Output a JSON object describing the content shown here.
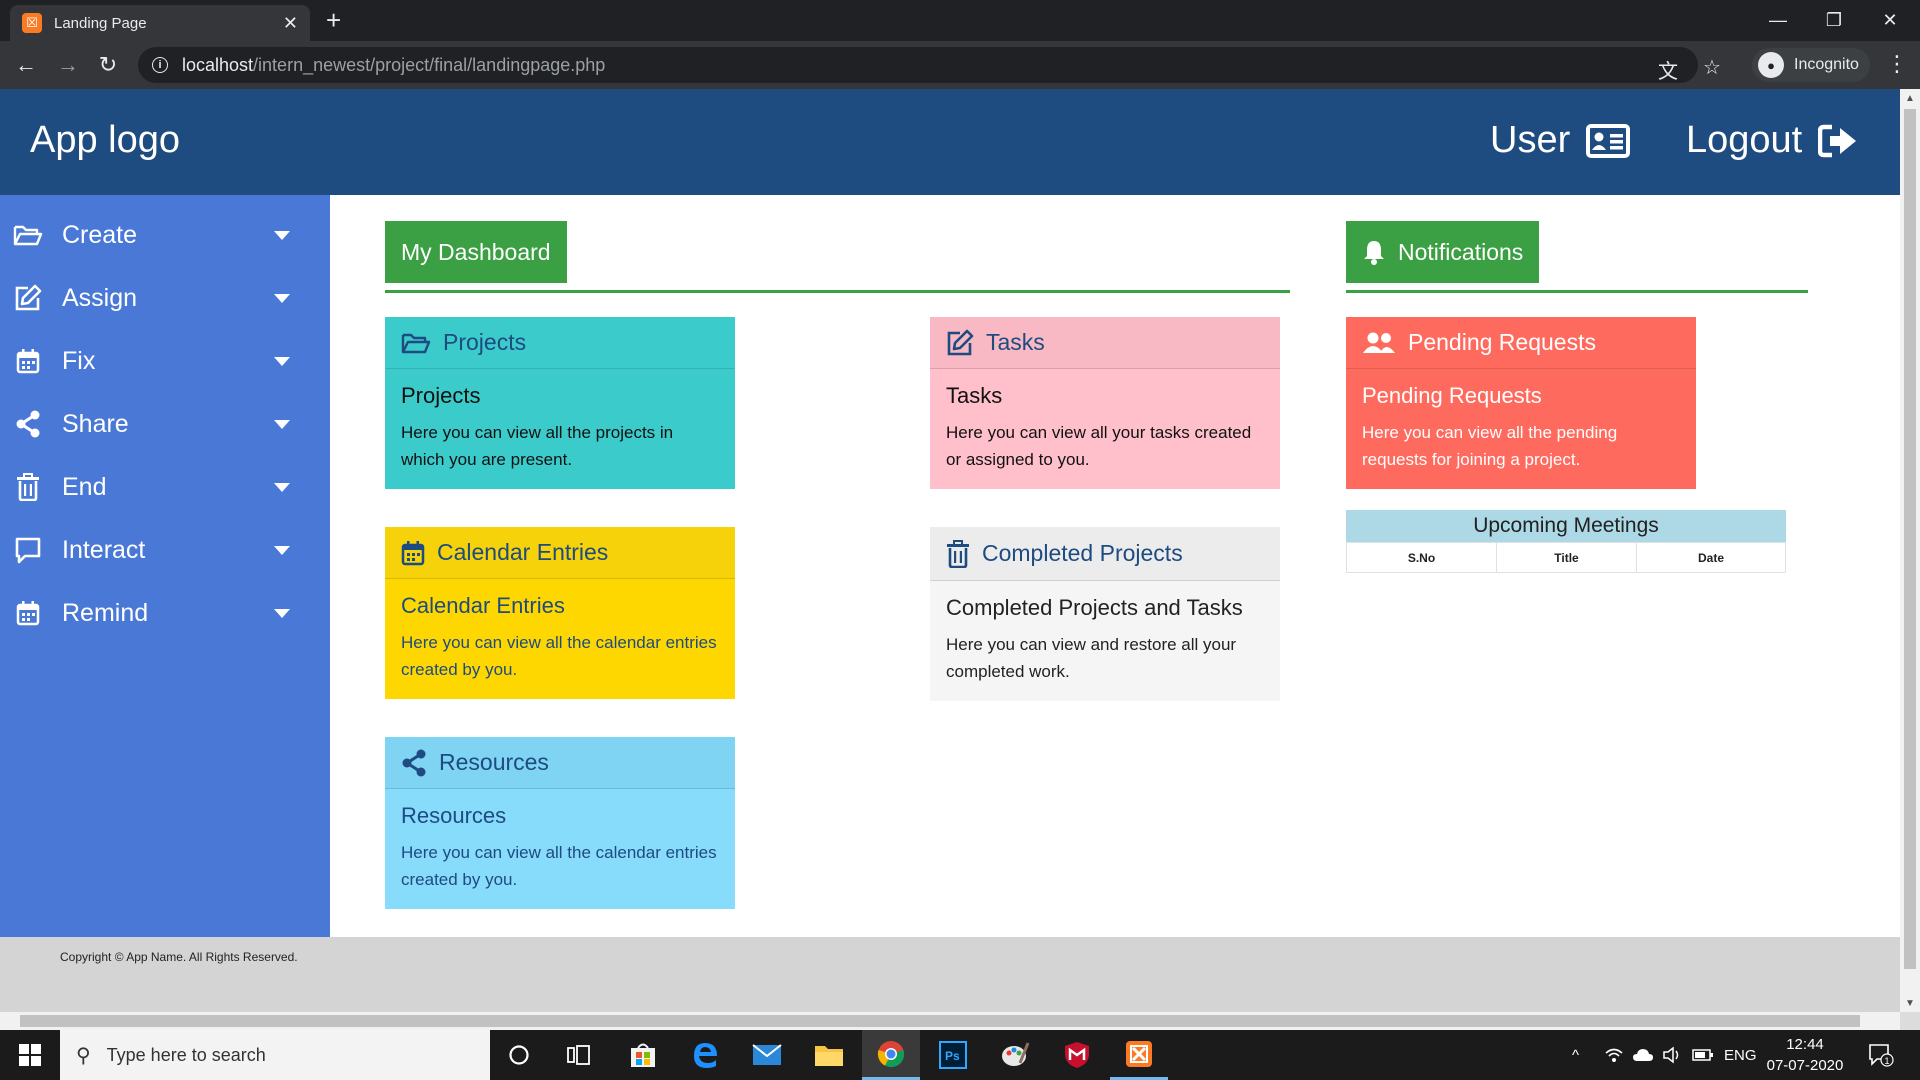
{
  "browser": {
    "tab_title": "Landing Page",
    "url_host": "localhost",
    "url_path": "/intern_newest/project/final/landingpage.php",
    "profile_label": "Incognito"
  },
  "header": {
    "logo": "App logo",
    "user_label": "User",
    "logout_label": "Logout"
  },
  "sidebar": {
    "items": [
      {
        "label": "Create",
        "icon": "folder-open-icon"
      },
      {
        "label": "Assign",
        "icon": "edit-icon"
      },
      {
        "label": "Fix",
        "icon": "calendar-icon"
      },
      {
        "label": "Share",
        "icon": "share-icon"
      },
      {
        "label": "End",
        "icon": "trash-icon"
      },
      {
        "label": "Interact",
        "icon": "comment-icon"
      },
      {
        "label": "Remind",
        "icon": "calendar-icon"
      }
    ]
  },
  "dashboard": {
    "button_label": "My Dashboard",
    "cards": {
      "projects": {
        "header": "Projects",
        "title": "Projects",
        "text": "Here you can view all the projects in which you are present."
      },
      "tasks": {
        "header": "Tasks",
        "title": "Tasks",
        "text": "Here you can view all your tasks created or assigned to you."
      },
      "calendar": {
        "header": "Calendar Entries",
        "title": "Calendar Entries",
        "text": "Here you can view all the calendar entries created by you."
      },
      "completed": {
        "header": "Completed Projects",
        "title": "Completed Projects and Tasks",
        "text": "Here you can view and restore all your completed work."
      },
      "resources": {
        "header": "Resources",
        "title": "Resources",
        "text": "Here you can view all the calendar entries created by you."
      }
    }
  },
  "notifications": {
    "button_label": "Notifications",
    "pending": {
      "header": "Pending Requests",
      "title": "Pending Requests",
      "text": "Here you can view all the pending requests for joining a project."
    },
    "meetings": {
      "title": "Upcoming Meetings",
      "columns": [
        "S.No",
        "Title",
        "Date"
      ]
    }
  },
  "footer": {
    "copyright": "Copyright © App Name. All Rights Reserved."
  },
  "taskbar": {
    "search_placeholder": "Type here to search",
    "language": "ENG",
    "time": "12:44",
    "date": "07-07-2020",
    "notification_count": "1"
  },
  "colors": {
    "header_bg": "#1e4b80",
    "sidebar_bg": "#4a78d6",
    "green": "#3aa043",
    "projects": "#3ccbcb",
    "tasks": "#ffc0cb",
    "calendar": "#ffd700",
    "completed": "#f5f5f5",
    "resources": "#87dbfb",
    "pending": "#ff6a5e"
  }
}
